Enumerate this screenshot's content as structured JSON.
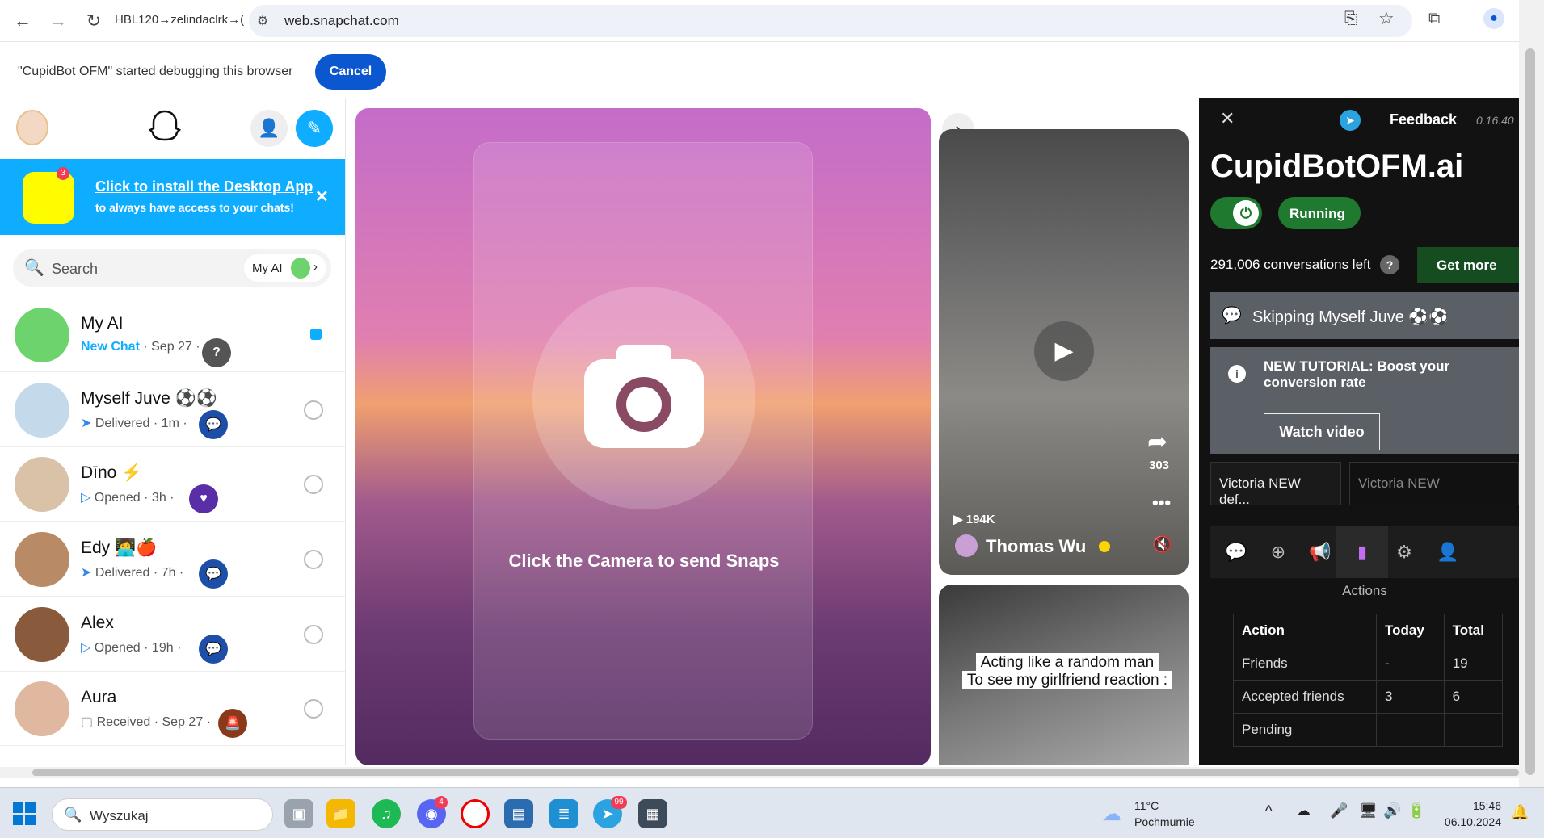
{
  "browser": {
    "tab_title": "HBL120→zelindaclrk→(",
    "url": "web.snapchat.com",
    "debug_message": "\"CupidBot OFM\" started debugging this browser",
    "cancel_label": "Cancel"
  },
  "snapchat": {
    "install_banner": {
      "link": "Click to install the Desktop App",
      "subtitle": "to always have access to your chats!",
      "badge": "3"
    },
    "search": {
      "placeholder": "Search",
      "my_ai_label": "My AI"
    },
    "chats": [
      {
        "name": "My AI",
        "status_prefix": "New Chat",
        "status": "· Sep 27 ·"
      },
      {
        "name": "Myself Juve ⚽⚽",
        "status_prefix": "Delivered",
        "status": "· 1m ·"
      },
      {
        "name": "Dīno ⚡",
        "status_prefix": "Opened",
        "status": "· 3h ·"
      },
      {
        "name": "Edy 👩‍💻🍎",
        "status_prefix": "Delivered",
        "status": "· 7h ·"
      },
      {
        "name": "Alex",
        "status_prefix": "Opened",
        "status": "· 19h ·"
      },
      {
        "name": "Aura",
        "status_prefix": "Received",
        "status": "· Sep 27 ·"
      }
    ],
    "camera_prompt": "Click the Camera to send Snaps",
    "story1": {
      "views": "194K",
      "shares": "303",
      "creator": "Thomas Wu"
    },
    "story2": {
      "caption_line1": "Acting like a random man",
      "caption_line2": "To see my girlfriend reaction :"
    }
  },
  "cupidbot": {
    "feedback": "Feedback",
    "version": "0.16.40",
    "title": "CupidBotOFM.ai",
    "running": "Running",
    "conversations_left": "291,006 conversations left",
    "get_more": "Get more",
    "skipping": "Skipping Myself Juve ⚽⚽",
    "tutorial_text": "NEW TUTORIAL: Boost your conversion rate",
    "watch_video": "Watch video",
    "select1": "Victoria NEW def...",
    "select2_placeholder": "Victoria NEW",
    "actions_label": "Actions",
    "table": {
      "headers": [
        "Action",
        "Today",
        "Total"
      ],
      "rows": [
        [
          "Friends",
          "-",
          "19"
        ],
        [
          "Accepted friends",
          "3",
          "6"
        ],
        [
          "Pending",
          "",
          ""
        ]
      ]
    }
  },
  "taskbar": {
    "search_placeholder": "Wyszukaj",
    "weather_temp": "11°C",
    "weather_desc": "Pochmurnie",
    "time": "15:46",
    "date": "06.10.2024",
    "discord_badge": "4",
    "telegram_badge": "99"
  }
}
